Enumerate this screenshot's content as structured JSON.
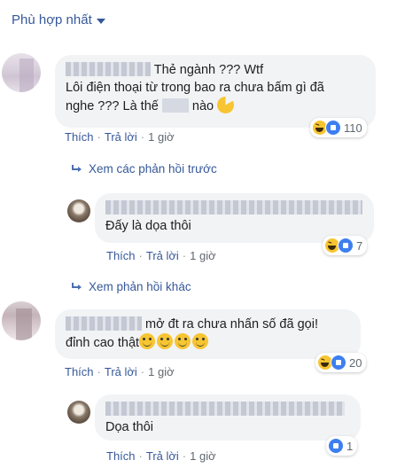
{
  "sort": {
    "label": "Phù hợp nhất"
  },
  "labels": {
    "like": "Thích",
    "reply": "Trả lời",
    "dot": "·"
  },
  "comments": [
    {
      "suffix": "Thẻ ngành ??? Wtf",
      "line2": "Lôi điện thoại từ trong bao ra chưa bấm gì đã",
      "line3a": "nghe ??? Là thế",
      "line3b": "nào",
      "time": "1 giờ",
      "react_count": "110",
      "icons": [
        "haha-icon",
        "like-icon"
      ]
    },
    {
      "line1": "mở đt ra chưa nhấn số đã gọi!",
      "line2": "đỉnh cao thật",
      "time": "1 giờ",
      "react_count": "20",
      "icons": [
        "haha-icon",
        "like-icon"
      ]
    }
  ],
  "replies": [
    {
      "text": "Đấy là dọa thôi",
      "time": "1 giờ",
      "react_count": "7"
    },
    {
      "text": "Dọa thôi",
      "time": "1 giờ",
      "react_count": "1"
    }
  ],
  "more": {
    "previous": "Xem các phản hồi trước",
    "other": "Xem phản hồi khác"
  }
}
